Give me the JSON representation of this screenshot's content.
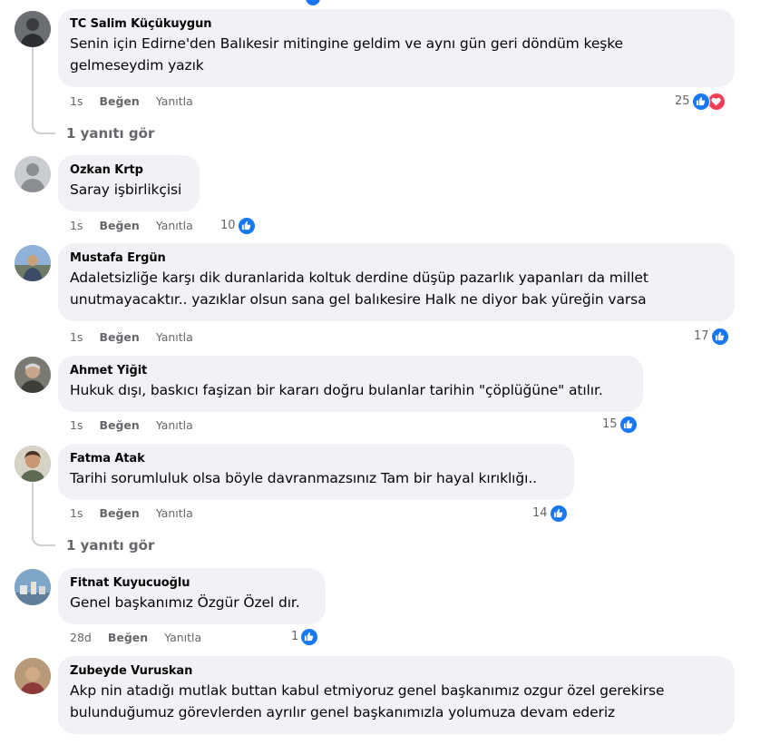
{
  "comments": [
    {
      "author": "TC Salim Küçükuygun",
      "text_line1": "Senin için Edirne'den Balıkesir mitingine geldim ve aynı gün geri döndüm keşke",
      "text_line2": "gelmeseydim yazık",
      "time": "1s",
      "like_label": "Beğen",
      "reply_label": "Yanıtla",
      "reaction_count": "25",
      "view_replies": "1 yanıtı gör"
    },
    {
      "author": "Ozkan Krtp",
      "text_line1": "Saray işbirlikçisi",
      "time": "1s",
      "like_label": "Beğen",
      "reply_label": "Yanıtla",
      "reaction_count": "10"
    },
    {
      "author": "Mustafa Ergün",
      "text_line1": "Adaletsizliğe karşı dik duranlarida koltuk derdine düşüp pazarlık yapanları da millet",
      "text_line2": "unutmayacaktır.. yazıklar olsun sana gel balıkesire Halk ne diyor bak yüreğin varsa",
      "time": "1s",
      "like_label": "Beğen",
      "reply_label": "Yanıtla",
      "reaction_count": "17"
    },
    {
      "author": "Ahmet Yiğit",
      "text_line1": "Hukuk dışı, baskıcı faşizan bir kararı doğru bulanlar tarihin \"çöplüğüne\" atılır.",
      "time": "1s",
      "like_label": "Beğen",
      "reply_label": "Yanıtla",
      "reaction_count": "15"
    },
    {
      "author": "Fatma Atak",
      "text_line1": "Tarihi sorumluluk olsa böyle davranmazsınız Tam bir hayal kırıklığı..",
      "time": "1s",
      "like_label": "Beğen",
      "reply_label": "Yanıtla",
      "reaction_count": "14",
      "view_replies": "1 yanıtı gör"
    },
    {
      "author": "Fitnat Kuyucuoğlu",
      "text_line1": "Genel başkanımız Özgür Özel dır.",
      "time": "28d",
      "like_label": "Beğen",
      "reply_label": "Yanıtla",
      "reaction_count": "1"
    },
    {
      "author": "Zubeyde Vuruskan",
      "text_line1": "Akp nin atadığı mutlak buttan kabul etmiyoruz genel başkanımız ozgur özel gerekirse",
      "text_line2": "bulunduğumuz görevlerden ayrılır genel başkanımızla yolumuza devam ederiz"
    }
  ],
  "colors": {
    "bubble": "#f0f2f5",
    "meta": "#65676b",
    "like": "#1877f2",
    "love": "#f33e58"
  }
}
